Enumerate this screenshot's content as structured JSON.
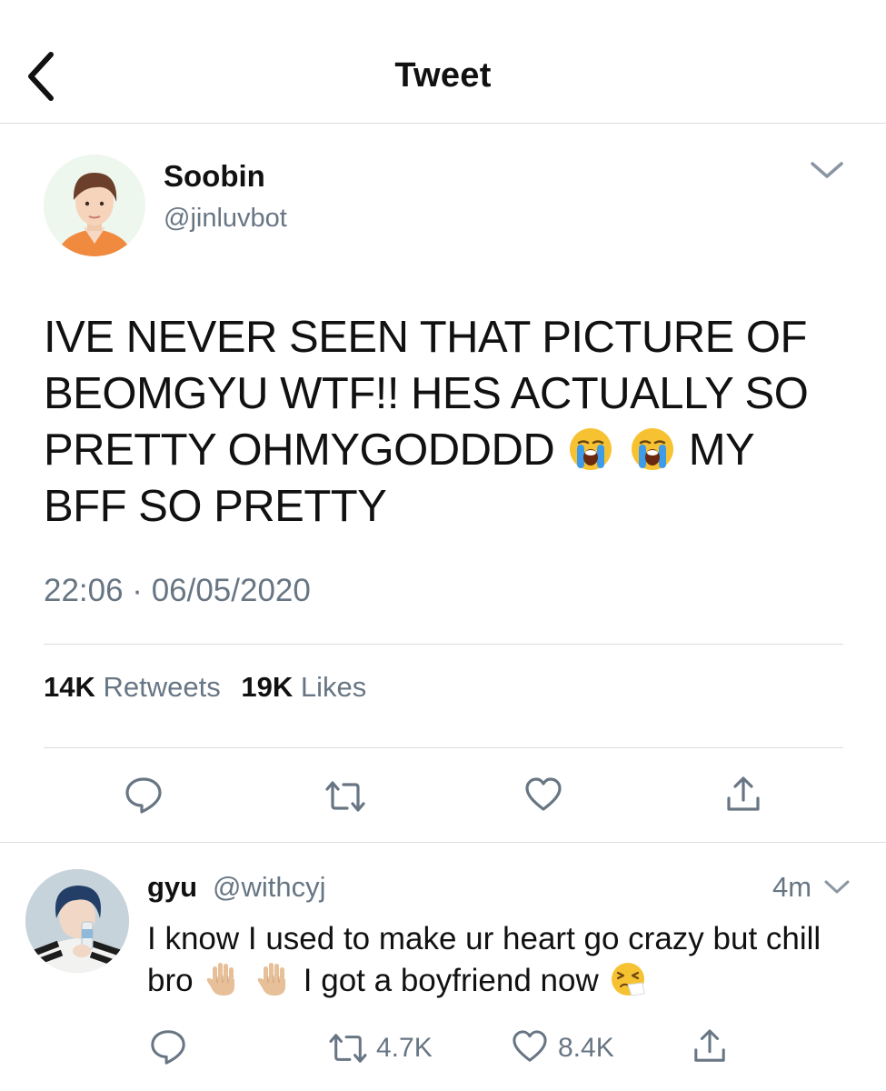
{
  "header": {
    "title": "Tweet",
    "back_icon": "chevron-left-icon"
  },
  "tweet": {
    "author": {
      "name": "Soobin",
      "handle": "@jinluvbot"
    },
    "text_part1": "IVE NEVER SEEN THAT PICTURE OF BEOMGYU WTF!! HES ACTUALLY SO PRETTY OHMYGODDDD",
    "emoji_1": "loudly-crying-face",
    "emoji_2": "loudly-crying-face",
    "text_part2": "MY BFF SO PRETTY",
    "timestamp": "22:06 · 06/05/2020",
    "stats": {
      "retweets_count": "14K",
      "retweets_label": "Retweets",
      "likes_count": "19K",
      "likes_label": "Likes"
    },
    "actions": [
      "reply-icon",
      "retweet-icon",
      "like-icon",
      "share-icon"
    ]
  },
  "reply": {
    "author": {
      "name": "gyu",
      "handle": "@withcyj"
    },
    "time": "4m",
    "text_part1": "I know I used to make ur heart go crazy but chill bro",
    "emoji_1": "raised-hand",
    "emoji_2": "raised-hand",
    "text_part2": "I got a boyfriend now",
    "emoji_3": "sneezing-face",
    "retweets": "4.7K",
    "likes": "8.4K"
  },
  "colors": {
    "text": "#111111",
    "secondary": "#687684",
    "divider": "#d9dde1",
    "emoji_yellow": "#f7c232",
    "tear_blue": "#3d9be9",
    "skin_tone": "#e7bf98"
  }
}
